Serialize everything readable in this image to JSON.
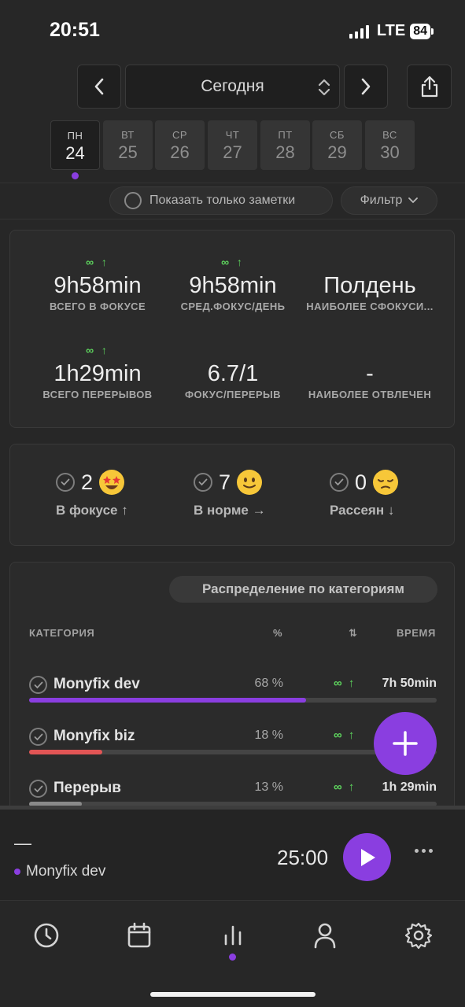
{
  "status_bar": {
    "time": "20:51",
    "network": "LTE",
    "battery": "84"
  },
  "date_nav": {
    "label": "Сегодня"
  },
  "week": [
    {
      "name": "ПН",
      "num": "24",
      "active": true
    },
    {
      "name": "ВТ",
      "num": "25"
    },
    {
      "name": "СР",
      "num": "26"
    },
    {
      "name": "ЧТ",
      "num": "27"
    },
    {
      "name": "ПТ",
      "num": "28"
    },
    {
      "name": "СБ",
      "num": "29"
    },
    {
      "name": "ВС",
      "num": "30"
    }
  ],
  "filters": {
    "notes_only": "Показать только заметки",
    "filter": "Фильтр"
  },
  "stats": [
    {
      "trend": "∞ ↑",
      "value": "9h58min",
      "label": "ВСЕГО В ФОКУСЕ"
    },
    {
      "trend": "∞ ↑",
      "value": "9h58min",
      "label": "СРЕД.ФОКУС/ДЕНЬ"
    },
    {
      "trend": "",
      "value": "Полдень",
      "label": "НАИБОЛЕЕ СФОКУСИ..."
    },
    {
      "trend": "∞ ↑",
      "value": "1h29min",
      "label": "ВСЕГО ПЕРЕРЫВОВ"
    },
    {
      "trend": "",
      "value": "6.7/1",
      "label": "ФОКУС/ПЕРЕРЫВ"
    },
    {
      "trend": "",
      "value": "-",
      "label": "НАИБОЛЕЕ ОТВЛЕЧЕН"
    }
  ],
  "moods": [
    {
      "count": "2",
      "label": "В фокусе ↑",
      "emoji": "star-struck-emoji"
    },
    {
      "count": "7",
      "label": "В норме →",
      "emoji": "smile-emoji"
    },
    {
      "count": "0",
      "label": "Рассеян ↓",
      "emoji": "pensive-emoji"
    }
  ],
  "categories": {
    "title": "Распределение по категориям",
    "headers": {
      "category": "КАТЕГОРИЯ",
      "percent": "%",
      "sort": "⇅",
      "time": "ВРЕМЯ"
    },
    "rows": [
      {
        "name": "Monyfix dev",
        "percent": "68 %",
        "trend": "∞ ↑",
        "time": "7h 50min",
        "share": 0.68,
        "color": "#8a3ee0"
      },
      {
        "name": "Monyfix biz",
        "percent": "18 %",
        "trend": "∞ ↑",
        "time": "",
        "share": 0.18,
        "color": "#e25555"
      },
      {
        "name": "Перерыв",
        "percent": "13 %",
        "trend": "∞ ↑",
        "time": "1h 29min",
        "share": 0.13,
        "color": "#8a8a8a"
      }
    ]
  },
  "timer": {
    "dash": "—",
    "task": "Monyfix dev",
    "time": "25:00"
  },
  "colors": {
    "accent": "#8a3ee0",
    "positive": "#5ed65e",
    "background": "#272727"
  },
  "tabs": [
    "clock-icon",
    "calendar-icon",
    "stats-icon",
    "profile-icon",
    "settings-icon"
  ]
}
